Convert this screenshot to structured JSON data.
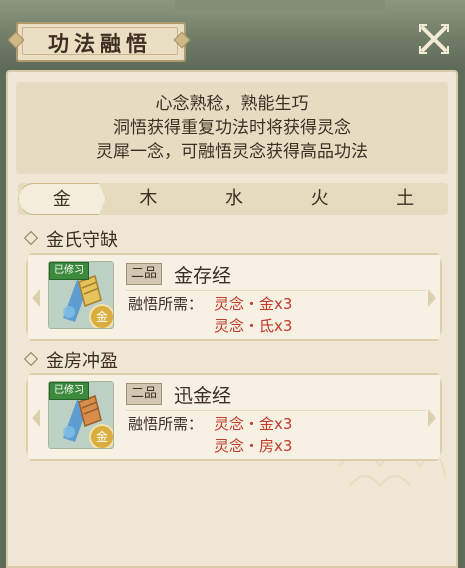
{
  "header": {
    "title": "功法融悟",
    "close_icon": "close-icon"
  },
  "info": {
    "line1": "心念熟稔，熟能生巧",
    "line2": "洞悟获得重复功法时将获得灵念",
    "line3": "灵犀一念，可融悟灵念获得高品功法"
  },
  "tabs": {
    "items": [
      {
        "label": "金",
        "selected": true
      },
      {
        "label": "木",
        "selected": false
      },
      {
        "label": "水",
        "selected": false
      },
      {
        "label": "火",
        "selected": false
      },
      {
        "label": "土",
        "selected": false
      }
    ]
  },
  "sections": [
    {
      "title": "金氏守缺",
      "card": {
        "badge": "已修习",
        "element": "金",
        "grade": "二品",
        "name": "金存经",
        "req_label": "融悟所需：",
        "req1": "灵念・金x3",
        "req2": "灵念・氐x3"
      }
    },
    {
      "title": "金房冲盈",
      "card": {
        "badge": "已修习",
        "element": "金",
        "grade": "二品",
        "name": "迅金经",
        "req_label": "融悟所需：",
        "req1": "灵念・金x3",
        "req2": "灵念・房x3"
      }
    }
  ],
  "colors": {
    "accent": "#c23a2a",
    "badge": "#3c8a3c",
    "panel": "#efe7d3"
  }
}
